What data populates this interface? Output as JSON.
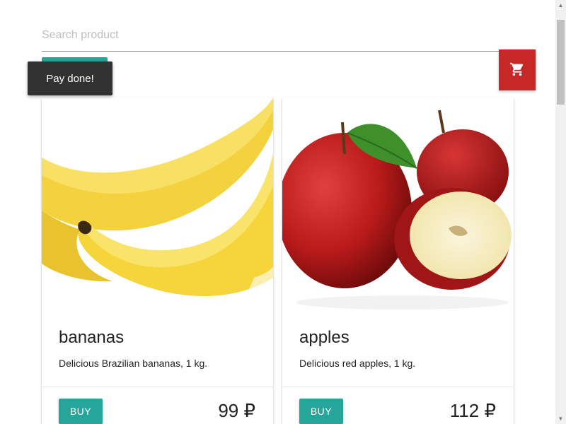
{
  "search": {
    "placeholder": "Search product",
    "value": ""
  },
  "toast": {
    "message": "Pay done!"
  },
  "pay_button": {
    "label": ""
  },
  "cart": {
    "icon": "shopping-cart-icon",
    "color": "#c62828"
  },
  "accent_color": "#26a69a",
  "products": [
    {
      "name": "bananas",
      "description": "Delicious Brazilian bananas, 1 kg.",
      "buy_label": "BUY",
      "price": "99 ₽"
    },
    {
      "name": "apples",
      "description": "Delicious red apples, 1 kg.",
      "buy_label": "BUY",
      "price": "112 ₽"
    }
  ]
}
